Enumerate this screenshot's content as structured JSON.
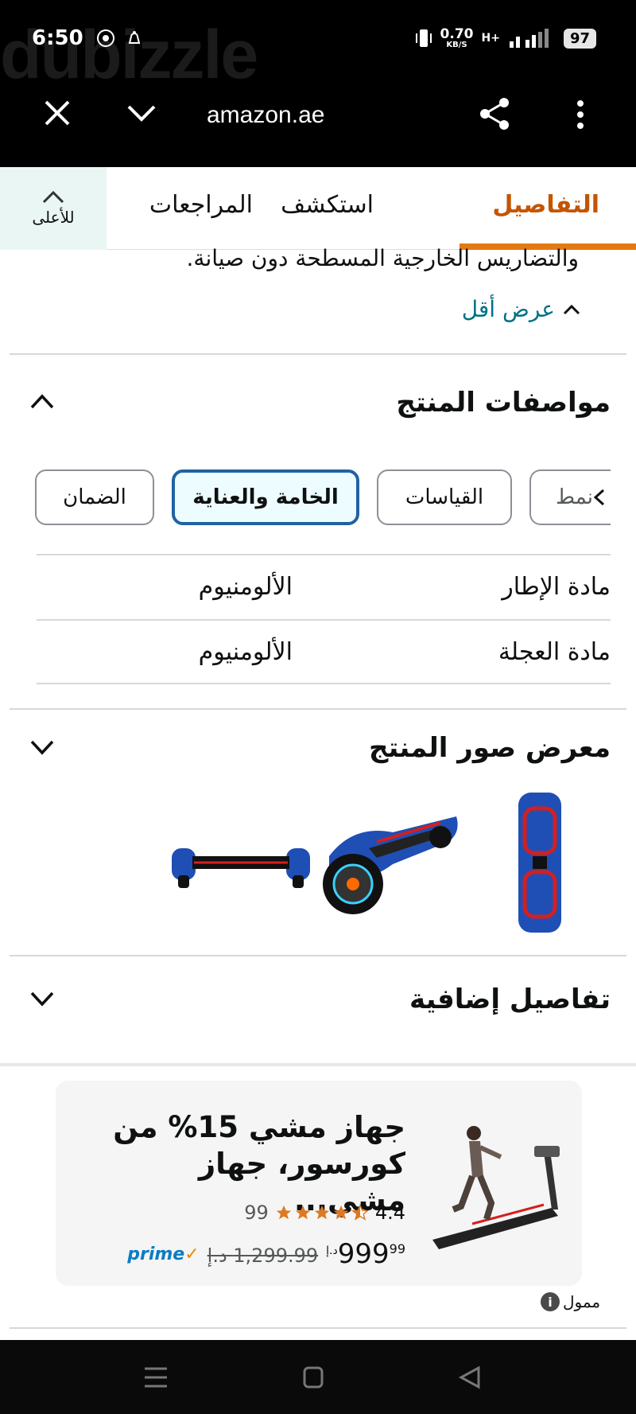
{
  "status_bar": {
    "time": "6:50",
    "net_speed": "0.70",
    "net_unit": "KB/S",
    "network": "H+",
    "battery": "97"
  },
  "watermark": "dubizzle",
  "browser": {
    "url": "amazon.ae"
  },
  "tabs": {
    "items": [
      {
        "label": "التفاصيل",
        "active": true
      },
      {
        "label": "استكشف",
        "active": false
      },
      {
        "label": "المراجعات",
        "active": false
      }
    ],
    "to_top_label": "للأعلى"
  },
  "description": {
    "tail_text": "والتضاريس الخارجية المسطحة دون صيانة.",
    "show_less": "عرض أقل"
  },
  "specs": {
    "title": "مواصفات المنتج",
    "chips": [
      {
        "label": "نمط",
        "selected": false
      },
      {
        "label": "القياسات",
        "selected": false
      },
      {
        "label": "الخامة والعناية",
        "selected": true
      },
      {
        "label": "الضمان",
        "selected": false
      }
    ],
    "rows": [
      {
        "label": "مادة الإطار",
        "value": "الألومنيوم"
      },
      {
        "label": "مادة العجلة",
        "value": "الألومنيوم"
      }
    ]
  },
  "gallery": {
    "title": "معرض صور المنتج"
  },
  "additional": {
    "title": "تفاصيل إضافية"
  },
  "ad": {
    "title": "جهاز مشي 15% من كورسور، جهاز مشي...",
    "rating": "4.4",
    "stars": 4.5,
    "review_count": "99",
    "price_currency": "د.إ",
    "price_whole": "999",
    "price_fraction": "99",
    "old_price": "1,299.99 د.إ",
    "prime": "prime",
    "sponsored_label": "ممول"
  },
  "colors": {
    "accent_orange": "#e47911",
    "active_tab_text": "#c45500",
    "link": "#007185",
    "selected_chip_border": "#2162a1",
    "hoverboard_blue": "#1f4fb4",
    "hoverboard_red": "#d41f1f"
  }
}
